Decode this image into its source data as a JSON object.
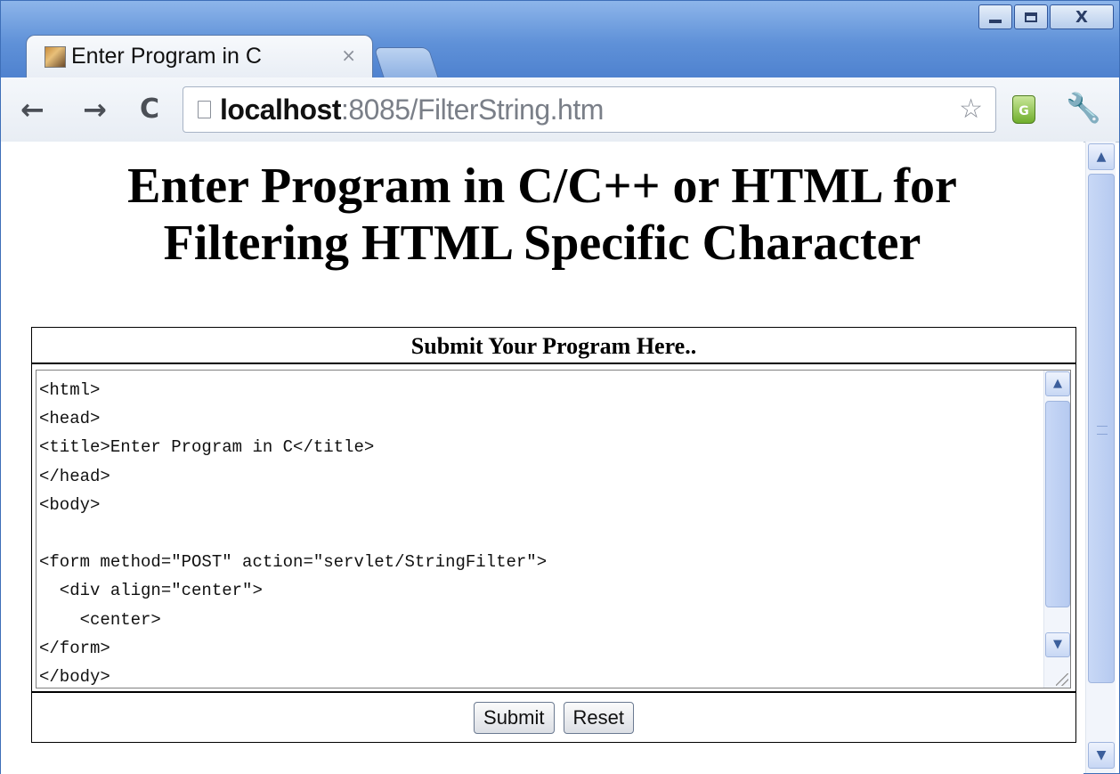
{
  "browser": {
    "tab_title": "Enter Program in C",
    "tab_close": "×",
    "url_host": "localhost",
    "url_rest": ":8085/FilterString.htm",
    "ext_label": "G"
  },
  "page": {
    "heading_line1": "Enter Program in C/C++ or HTML for",
    "heading_line2": "Filtering HTML Specific Character",
    "form_caption": "Submit Your Program Here..",
    "code_text": "<html>\n<head>\n<title>Enter Program in C</title>\n</head>\n<body>\n\n<form method=\"POST\" action=\"servlet/StringFilter\">\n  <div align=\"center\">\n    <center>\n</form>\n</body>",
    "submit_label": "Submit",
    "reset_label": "Reset"
  },
  "colors": {
    "titlebar": "#5f91d8",
    "scrollbar_thumb": "#c8d8f6"
  }
}
